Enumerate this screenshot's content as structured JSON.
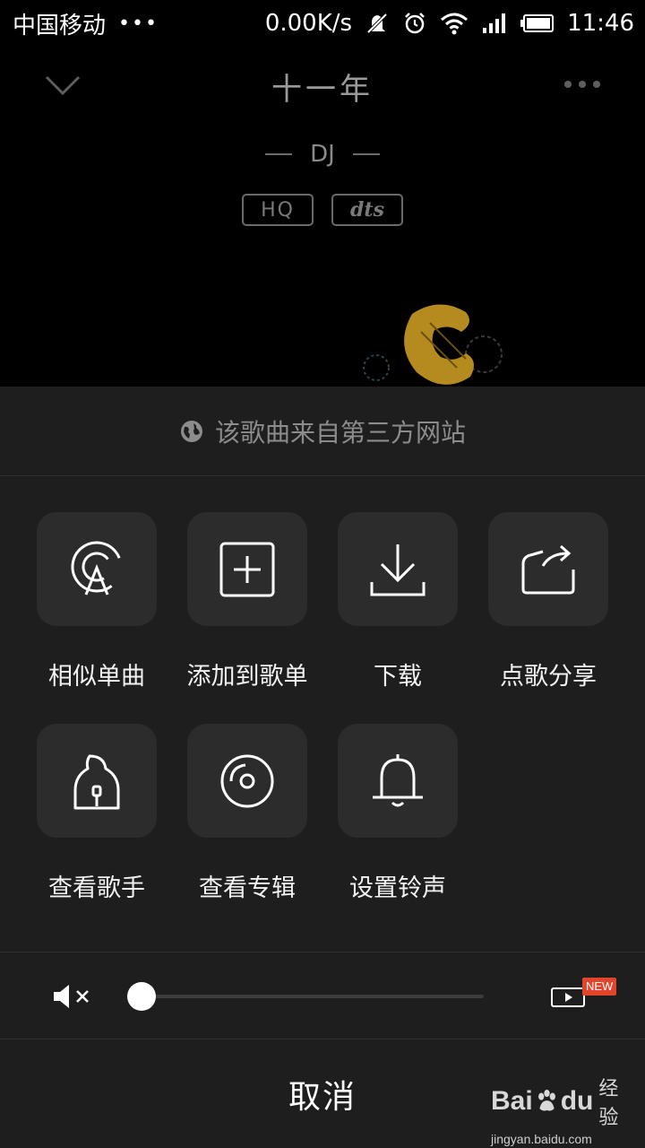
{
  "status_bar": {
    "carrier": "中国移动",
    "dots": "•••",
    "net_speed": "0.00K/s",
    "time": "11:46"
  },
  "player": {
    "title": "十一年",
    "artist": "DJ",
    "badges": [
      "HQ",
      "dts"
    ]
  },
  "sheet": {
    "source_note": "该歌曲来自第三方网站",
    "actions": [
      {
        "label": "相似单曲",
        "icon": "radar-icon"
      },
      {
        "label": "添加到歌单",
        "icon": "plus-square-icon"
      },
      {
        "label": "下载",
        "icon": "download-icon"
      },
      {
        "label": "点歌分享",
        "icon": "share-icon"
      },
      {
        "label": "查看歌手",
        "icon": "singer-icon"
      },
      {
        "label": "查看专辑",
        "icon": "disc-icon"
      },
      {
        "label": "设置铃声",
        "icon": "bell-icon"
      }
    ],
    "volume_level": 0,
    "new_badge": "NEW",
    "cancel_label": "取消"
  },
  "watermark": {
    "brand": "Bai",
    "brand2": "du",
    "brand_cn": "经验",
    "url": "jingyan.baidu.com"
  },
  "colors": {
    "background": "#000000",
    "sheet": "#1e1e1e",
    "tile": "#2c2c2c",
    "new_badge": "#e2452c"
  }
}
